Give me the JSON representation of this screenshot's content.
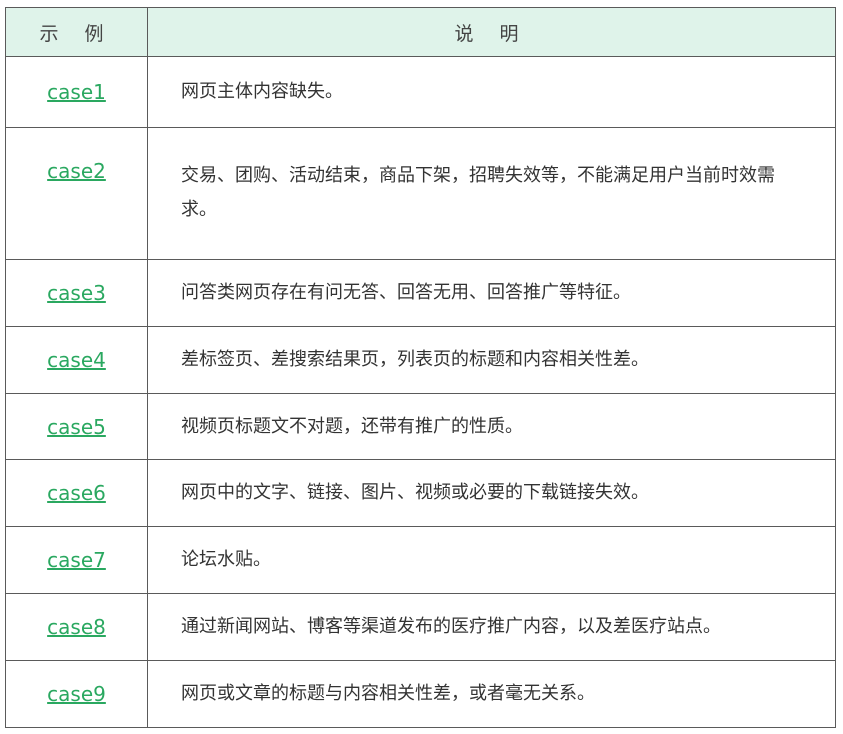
{
  "table": {
    "headers": [
      "示 例",
      "说 明"
    ],
    "rows": [
      {
        "example": "case1",
        "description": "网页主体内容缺失。"
      },
      {
        "example": "case2",
        "description": "交易、团购、活动结束，商品下架，招聘失效等，不能满足用户当前时效需求。"
      },
      {
        "example": "case3",
        "description": "问答类网页存在有问无答、回答无用、回答推广等特征。"
      },
      {
        "example": "case4",
        "description": "差标签页、差搜索结果页，列表页的标题和内容相关性差。"
      },
      {
        "example": "case5",
        "description": "视频页标题文不对题，还带有推广的性质。"
      },
      {
        "example": "case6",
        "description": "网页中的文字、链接、图片、视频或必要的下载链接失效。"
      },
      {
        "example": "case7",
        "description": "论坛水贴。"
      },
      {
        "example": "case8",
        "description": "通过新闻网站、博客等渠道发布的医疗推广内容，以及差医疗站点。"
      },
      {
        "example": "case9",
        "description": "网页或文章的标题与内容相关性差，或者毫无关系。"
      }
    ]
  },
  "colors": {
    "header_bg": "#dff3ea",
    "link": "#2aa860",
    "border": "#5a5a5a"
  }
}
